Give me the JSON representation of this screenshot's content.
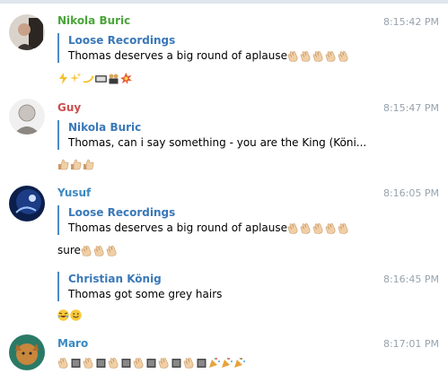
{
  "messages": [
    {
      "author": "Nikola Buric",
      "author_color": "#4aa53a",
      "time": "8:15:42 PM",
      "reply": {
        "author": "Loose Recordings",
        "text": "Thomas deserves a big round of aplause"
      },
      "lines": []
    },
    {
      "author": "Guy",
      "author_color": "#c94f4f",
      "time": "8:15:47 PM",
      "reply": {
        "author": "Nikola Buric",
        "text": "Thomas, can i say something - you are the King (Köni..."
      },
      "lines": []
    },
    {
      "author": "Yusuf",
      "author_color": "#3b8ac2",
      "time": "8:16:05 PM",
      "reply": {
        "author": "Loose Recordings",
        "text": "Thomas deserves a big round of aplause"
      },
      "lines": [
        {
          "text": "sure"
        }
      ]
    },
    {
      "author": "",
      "time": "8:16:45 PM",
      "reply": {
        "author": "Christian König",
        "text": "Thomas got some grey hairs"
      },
      "lines": []
    },
    {
      "author": "Maro",
      "author_color": "#3b8ac2",
      "time": "8:17:01 PM",
      "reply": null,
      "lines": []
    }
  ],
  "icons": [
    "avatar-nikola",
    "avatar-guy",
    "avatar-yusuf",
    "avatar-maro",
    "clap-emoji",
    "thumbs-up-emoji",
    "joy-emoji",
    "smile-emoji",
    "party-popper-emoji"
  ],
  "colors": {
    "accent_quote_bar": "#4b8bc9",
    "quote_author": "#3a78b8",
    "time": "#97a3ad"
  }
}
